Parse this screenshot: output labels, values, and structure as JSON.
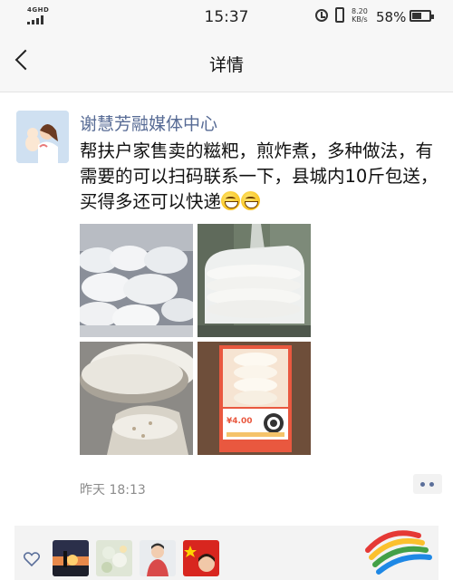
{
  "status_bar": {
    "network": "4GHD",
    "time": "15:37",
    "speed_value": "8.20",
    "speed_unit": "KB/s",
    "battery_text": "58%",
    "battery_level": 0.58
  },
  "nav": {
    "title": "详情"
  },
  "post": {
    "author": "谢慧芳融媒体中心",
    "text": "帮扶户家售卖的糍粑，煎炸煮，多种做法，有需要的可以扫码联系一下，县城内10斤包送，买得多还可以快递",
    "emoji": [
      "grinning-face-emoji",
      "grinning-face-emoji"
    ],
    "time": "昨天 18:13",
    "photos": [
      "photo-ciba-bags",
      "photo-ciba-stack",
      "photo-ciba-closeup",
      "photo-qr-poster"
    ],
    "poster_price": "¥4.00"
  },
  "likes": {
    "icon": "heart-icon",
    "avatars": [
      "like-avatar-sunset",
      "like-avatar-flowers",
      "like-avatar-person",
      "like-avatar-flag"
    ]
  },
  "colors": {
    "author_link": "#576b95",
    "bar_bg": "#f7f7f7",
    "likes_bg": "#f3f3f3",
    "time_gray": "#8c8c8c"
  }
}
